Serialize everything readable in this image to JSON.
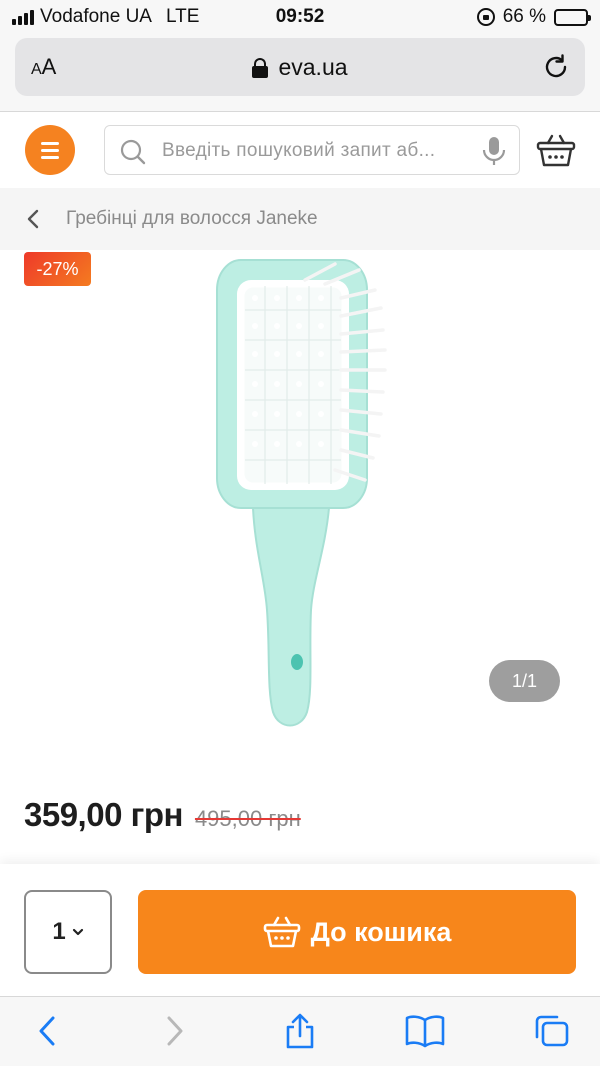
{
  "status_bar": {
    "carrier": "Vodafone UA",
    "network": "LTE",
    "time": "09:52",
    "battery": "66 %",
    "battery_level": 0.66
  },
  "browser": {
    "text_size_label": "AA",
    "url": "eva.ua"
  },
  "header": {
    "search_placeholder": "Введіть пошуковий запит аб...",
    "accent_color": "#f58220"
  },
  "breadcrumb": {
    "label": "Гребінці для волосся Janeke"
  },
  "product": {
    "discount_badge": "-27%",
    "image_counter": "1/1",
    "price_current": "359,00 грн",
    "price_old": "495,00 грн"
  },
  "purchase": {
    "quantity": "1",
    "add_to_cart_label": "До кошика",
    "button_color": "#f7861b"
  },
  "toolbar": {
    "icons": [
      "back-icon",
      "forward-icon",
      "share-icon",
      "bookmarks-icon",
      "tabs-icon"
    ]
  }
}
